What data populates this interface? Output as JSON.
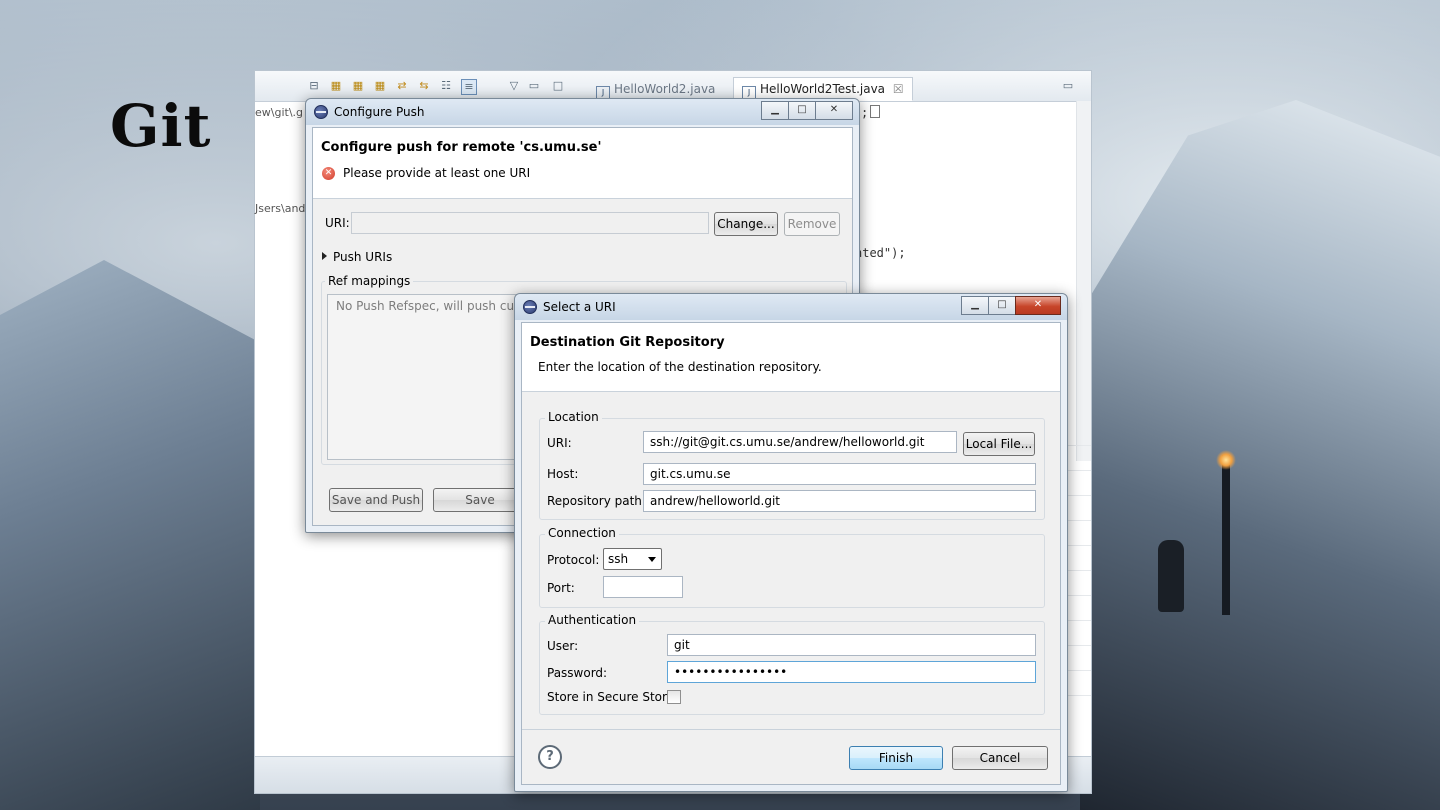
{
  "slide": {
    "title": "Git"
  },
  "ide": {
    "tabs": [
      {
        "label": "HelloWorld2.java",
        "active": false
      },
      {
        "label": "HelloWorld2Test.java",
        "active": true
      }
    ],
    "close_glyph": "☒",
    "path_fragment_1": "ew\\git\\.g",
    "path_fragment_2": "Jsers\\and",
    "code_fragment_1": ";",
    "code_fragment_2": "nted\");"
  },
  "configure_push": {
    "window_title": "Configure Push",
    "banner_title": "Configure push for remote 'cs.umu.se'",
    "error_message": "Please provide at least one URI",
    "uri_label": "URI:",
    "uri_value": "",
    "change_label": "Change...",
    "remove_label": "Remove",
    "push_uris_label": "Push URIs",
    "ref_mappings_label": "Ref mappings",
    "refspec_text": "No Push Refspec, will push curr",
    "save_and_push_label": "Save and Push",
    "save_label": "Save"
  },
  "select_uri": {
    "window_title": "Select a URI",
    "banner_title": "Destination Git Repository",
    "banner_desc": "Enter the location of the destination repository.",
    "location": {
      "group_label": "Location",
      "uri_label": "URI:",
      "uri_value": "ssh://git@git.cs.umu.se/andrew/helloworld.git",
      "local_file_label": "Local File...",
      "host_label": "Host:",
      "host_value": "git.cs.umu.se",
      "repo_path_label": "Repository path:",
      "repo_path_value": "andrew/helloworld.git"
    },
    "connection": {
      "group_label": "Connection",
      "protocol_label": "Protocol:",
      "protocol_value": "ssh",
      "port_label": "Port:",
      "port_value": ""
    },
    "authentication": {
      "group_label": "Authentication",
      "user_label": "User:",
      "user_value": "git",
      "password_label": "Password:",
      "password_value": "••••••••••••••••",
      "store_label": "Store in Secure Store",
      "store_checked": false
    },
    "help_glyph": "?",
    "finish_label": "Finish",
    "cancel_label": "Cancel"
  },
  "window_controls": {
    "minimize": "▁",
    "maximize": "□",
    "close": "✕"
  }
}
